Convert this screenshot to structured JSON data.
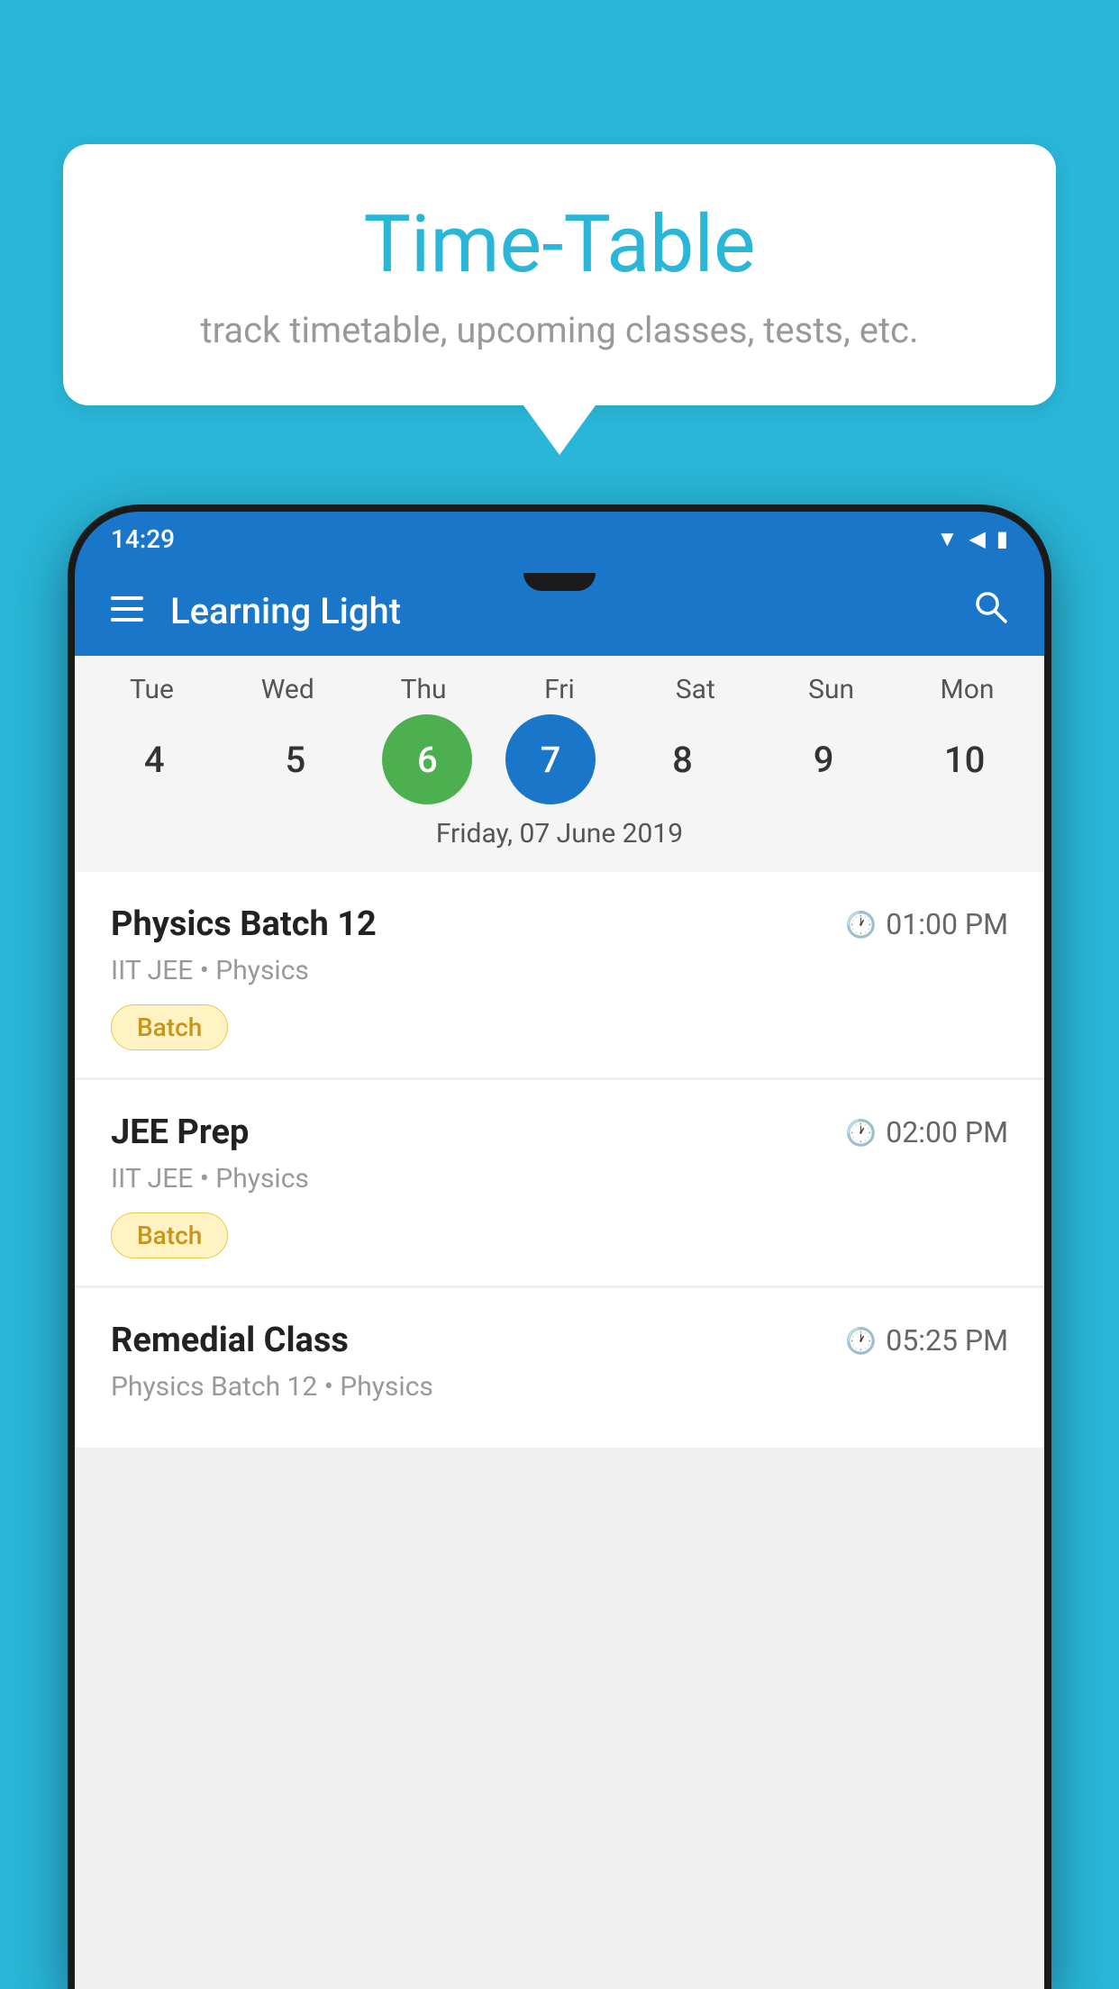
{
  "background_color": "#29B6D8",
  "speech_bubble": {
    "title": "Time-Table",
    "subtitle": "track timetable, upcoming classes, tests, etc."
  },
  "phone": {
    "status_bar": {
      "time": "14:29",
      "icons": [
        "wifi",
        "signal",
        "battery"
      ]
    },
    "app_bar": {
      "title": "Learning Light",
      "menu_icon": "hamburger",
      "search_icon": "search"
    },
    "calendar": {
      "days": [
        "Tue",
        "Wed",
        "Thu",
        "Fri",
        "Sat",
        "Sun",
        "Mon"
      ],
      "dates": [
        "4",
        "5",
        "6",
        "7",
        "8",
        "9",
        "10"
      ],
      "today_index": 2,
      "selected_index": 3,
      "selected_date_label": "Friday, 07 June 2019"
    },
    "schedule": [
      {
        "title": "Physics Batch 12",
        "time": "01:00 PM",
        "subtitle": "IIT JEE • Physics",
        "badge": "Batch"
      },
      {
        "title": "JEE Prep",
        "time": "02:00 PM",
        "subtitle": "IIT JEE • Physics",
        "badge": "Batch"
      },
      {
        "title": "Remedial Class",
        "time": "05:25 PM",
        "subtitle": "Physics Batch 12 • Physics",
        "badge": null
      }
    ]
  }
}
